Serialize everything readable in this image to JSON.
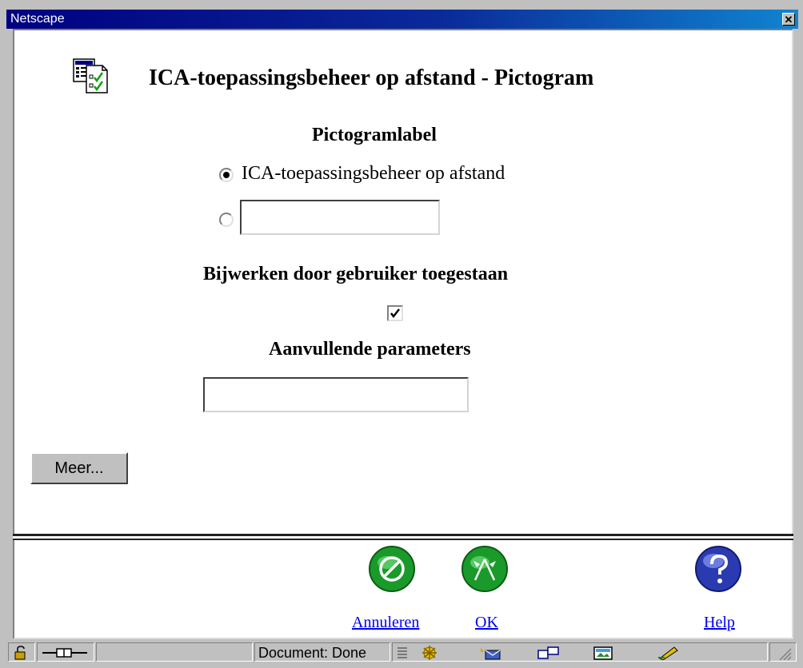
{
  "window": {
    "title": "Netscape",
    "close_icon": "close-x-icon"
  },
  "page": {
    "title": "ICA-toepassingsbeheer op afstand - Pictogram",
    "icon": "checklist-document-icon"
  },
  "form": {
    "label_heading": "Pictogramlabel",
    "radio_default_label": "ICA-toepassingsbeheer op afstand",
    "radio_default_selected": true,
    "radio_custom_selected": false,
    "custom_label_value": "",
    "user_update_heading": "Bijwerken door gebruiker toegestaan",
    "user_update_checked": true,
    "params_heading": "Aanvullende parameters",
    "params_value": "",
    "more_button": "Meer..."
  },
  "footer": {
    "cancel_label": "Annuleren",
    "ok_label": "OK",
    "help_label": "Help",
    "cancel_icon": "cancel-circle-icon",
    "ok_icon": "ok-flags-icon",
    "help_icon": "help-question-icon",
    "button_color": "#1a9a2a",
    "help_color": "#2a3ab0"
  },
  "statusbar": {
    "status_text": "Document: Done",
    "icons": [
      "security-lock-icon",
      "connection-icon",
      "navigator-icon",
      "mail-icon",
      "discussions-icon",
      "composer-icon",
      "edit-icon"
    ]
  }
}
